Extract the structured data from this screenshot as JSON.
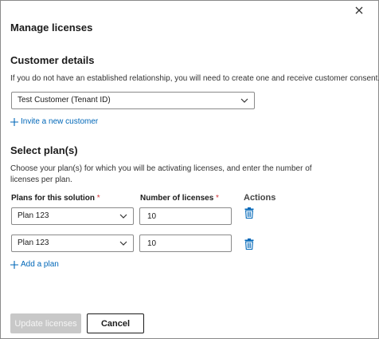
{
  "dialog": {
    "title": "Manage licenses",
    "close_icon": "close-icon"
  },
  "customer_details": {
    "heading": "Customer details",
    "description": "If you do not have an established relationship, you will need to create one and receive customer consent.",
    "customer_select_value": "Test Customer (Tenant ID)",
    "invite_link": "Invite a new customer"
  },
  "select_plans": {
    "heading": "Select plan(s)",
    "description_line1": "Choose your plan(s) for which you will be activating licenses, and enter the number of",
    "description_line2": "licenses per plan.",
    "columns": {
      "plans": "Plans for this solution",
      "licenses": "Number of licenses",
      "required_marker": "*",
      "actions": "Actions"
    },
    "rows": [
      {
        "plan": "Plan 123",
        "licenses": "10"
      },
      {
        "plan": "Plan 123",
        "licenses": "10"
      }
    ],
    "add_plan_link": "Add a plan"
  },
  "footer": {
    "update_label": "Update licenses",
    "cancel_label": "Cancel"
  },
  "colors": {
    "link": "#0067b8",
    "required": "#d13438",
    "disabled_button": "#c8c8c8",
    "trash_icon": "#0067b8"
  }
}
